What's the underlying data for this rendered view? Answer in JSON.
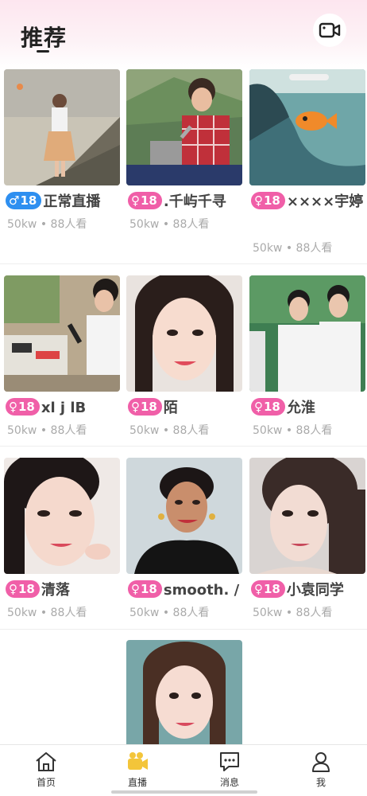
{
  "header": {
    "title": "推荐"
  },
  "icons": {
    "video": "video-camera-icon"
  },
  "badge_colors": {
    "male": "#2e8ff0",
    "female": "#f05fa8"
  },
  "cards": [
    {
      "badge_symbol": "♂",
      "badge_value": "18",
      "gender": "male",
      "name": "正常直播",
      "meta": "50kw • 88人看"
    },
    {
      "badge_symbol": "♀",
      "badge_value": "18",
      "gender": "female",
      "name": ".千屿千寻",
      "meta": "50kw • 88人看"
    },
    {
      "badge_symbol": "♀",
      "badge_value": "18",
      "gender": "female",
      "name": "××××宇婷",
      "meta": "50kw • 88人看"
    },
    {
      "badge_symbol": "♀",
      "badge_value": "18",
      "gender": "female",
      "name": "xl j lB",
      "meta": "50kw • 88人看"
    },
    {
      "badge_symbol": "♀",
      "badge_value": "18",
      "gender": "female",
      "name": "陌",
      "meta": "50kw • 88人看"
    },
    {
      "badge_symbol": "♀",
      "badge_value": "18",
      "gender": "female",
      "name": "允淮",
      "meta": "50kw • 88人看"
    },
    {
      "badge_symbol": "♀",
      "badge_value": "18",
      "gender": "female",
      "name": "清落",
      "meta": "50kw • 88人看"
    },
    {
      "badge_symbol": "♀",
      "badge_value": "18",
      "gender": "female",
      "name": "smooth. /",
      "meta": "50kw • 88人看"
    },
    {
      "badge_symbol": "♀",
      "badge_value": "18",
      "gender": "female",
      "name": "小袁同学",
      "meta": "50kw • 88人看"
    }
  ],
  "tabbar": [
    {
      "label": "首页",
      "icon": "home-icon",
      "active": false
    },
    {
      "label": "直播",
      "icon": "live-camera-icon",
      "active": true
    },
    {
      "label": "消息",
      "icon": "message-icon",
      "active": false
    },
    {
      "label": "我",
      "icon": "user-icon",
      "active": false
    }
  ]
}
